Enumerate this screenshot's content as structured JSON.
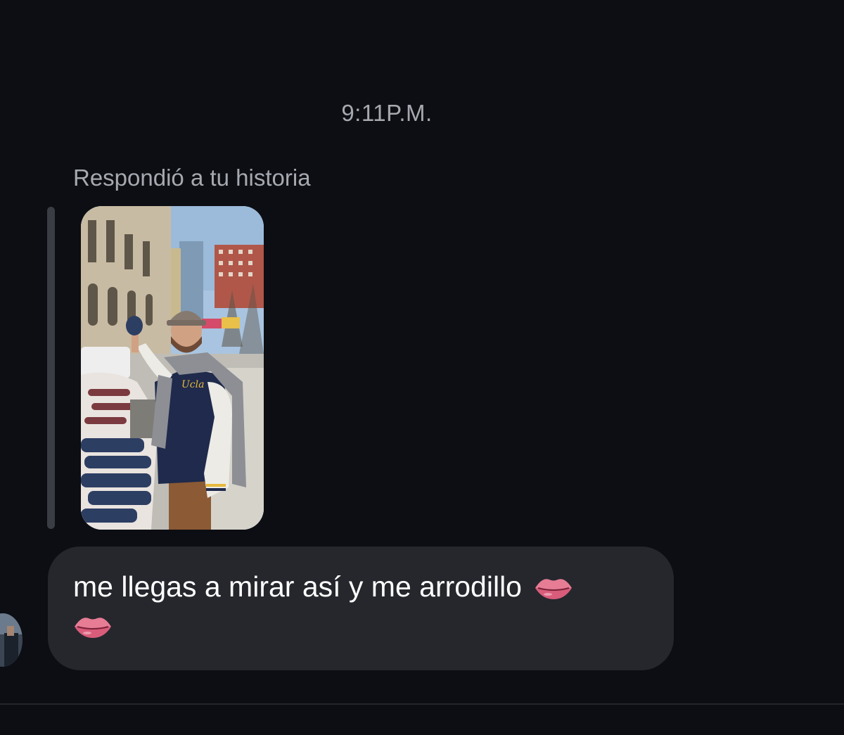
{
  "chat": {
    "timestamp": "9:11P.M.",
    "reply_context_label": "Respondió a tu historia",
    "message": {
      "text": "me llegas a mirar así y me arrodillo",
      "emoji_icons": [
        "lips-icon",
        "lips-icon"
      ]
    }
  },
  "colors": {
    "background": "#0c0e13",
    "bubble": "#25272d",
    "secondary_text": "#a6a9b0",
    "reply_bar": "#3a3d44"
  }
}
